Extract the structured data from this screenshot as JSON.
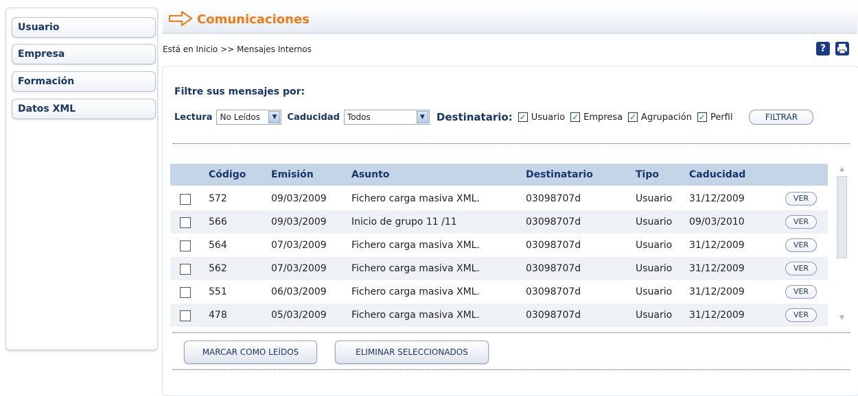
{
  "sidebar": {
    "items": [
      {
        "label": "Usuario"
      },
      {
        "label": "Empresa"
      },
      {
        "label": "Formación"
      },
      {
        "label": "Datos XML"
      }
    ]
  },
  "header": {
    "title": "Comunicaciones",
    "icon": "arrow-right-icon"
  },
  "breadcrumb": "Está en Inicio >> Mensajes Internos",
  "tools": {
    "help": "?",
    "print_icon": "print-icon"
  },
  "filter": {
    "title": "Filtre sus mensajes por:",
    "lectura_label": "Lectura",
    "lectura_value": "No Leídos",
    "caducidad_label": "Caducidad",
    "caducidad_value": "Todos",
    "destinatario_label": "Destinatario:",
    "checks": [
      {
        "label": "Usuario",
        "checked": true
      },
      {
        "label": "Empresa",
        "checked": true
      },
      {
        "label": "Agrupación",
        "checked": true
      },
      {
        "label": "Perfil",
        "checked": true
      }
    ],
    "button": "FILTRAR"
  },
  "table": {
    "headers": {
      "codigo": "Código",
      "emision": "Emisión",
      "asunto": "Asunto",
      "destinatario": "Destinatario",
      "tipo": "Tipo",
      "caducidad": "Caducidad"
    },
    "ver_label": "VER",
    "rows": [
      {
        "codigo": "572",
        "emision": "09/03/2009",
        "asunto": "Fichero carga masiva XML.",
        "destinatario": "03098707d",
        "tipo": "Usuario",
        "caducidad": "31/12/2009"
      },
      {
        "codigo": "566",
        "emision": "09/03/2009",
        "asunto": "Inicio de grupo 11 /11",
        "destinatario": "03098707d",
        "tipo": "Usuario",
        "caducidad": "09/03/2010"
      },
      {
        "codigo": "564",
        "emision": "07/03/2009",
        "asunto": "Fichero carga masiva XML.",
        "destinatario": "03098707d",
        "tipo": "Usuario",
        "caducidad": "31/12/2009"
      },
      {
        "codigo": "562",
        "emision": "07/03/2009",
        "asunto": "Fichero carga masiva XML.",
        "destinatario": "03098707d",
        "tipo": "Usuario",
        "caducidad": "31/12/2009"
      },
      {
        "codigo": "551",
        "emision": "06/03/2009",
        "asunto": "Fichero carga masiva XML.",
        "destinatario": "03098707d",
        "tipo": "Usuario",
        "caducidad": "31/12/2009"
      },
      {
        "codigo": "478",
        "emision": "05/03/2009",
        "asunto": "Fichero carga masiva XML.",
        "destinatario": "03098707d",
        "tipo": "Usuario",
        "caducidad": "31/12/2009"
      }
    ]
  },
  "actions": {
    "mark_read": "MARCAR COMO LEÍDOS",
    "delete_selected": "ELIMINAR SELECCIONADOS"
  },
  "colors": {
    "accent": "#f07a14",
    "navy": "#17366b",
    "table_header": "#c4d5e8",
    "row_alt": "#eef1f5"
  }
}
